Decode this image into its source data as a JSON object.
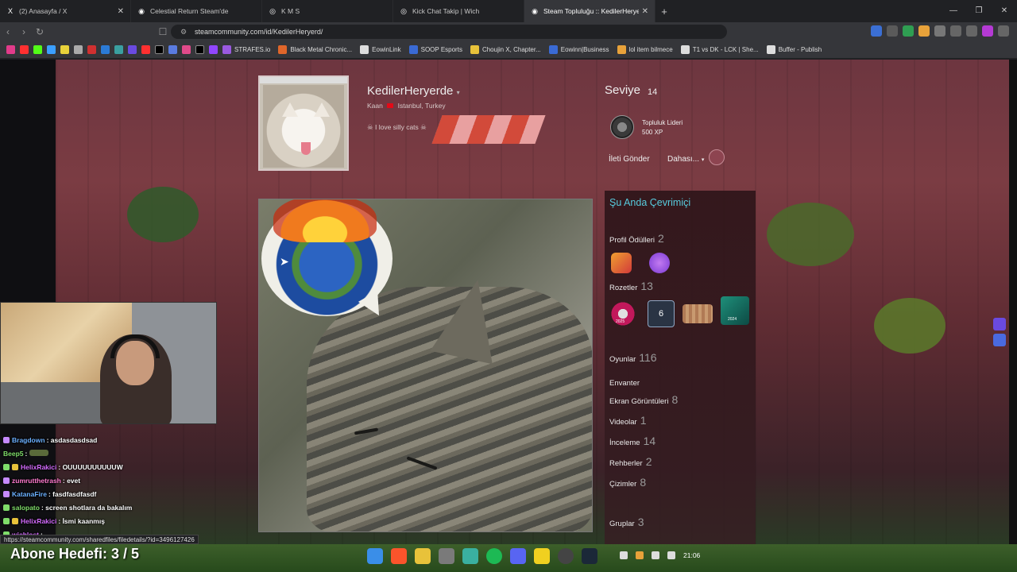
{
  "browser": {
    "tabs": [
      {
        "title": "(2) Anasayfa / X",
        "icon": "x-logo-icon"
      },
      {
        "title": "Celestial Return Steam'de",
        "icon": "steam-icon"
      },
      {
        "title": "K M S",
        "icon": "globe-icon"
      },
      {
        "title": "Kick Chat Takip | Wich",
        "icon": "globe-icon"
      },
      {
        "title": "Steam Topluluğu :: KedilerHeryerde",
        "icon": "steam-icon",
        "active": true
      }
    ],
    "url": "steamcommunity.com/id/KedilerHeryerd/",
    "bookmarks": [
      "STRAFES.io",
      "Black Metal Chronic...",
      "EowinLink",
      "SOOP Esports",
      "Choujin X, Chapter...",
      "Eowinn|Business",
      "lol item bilmece",
      "T1 vs DK - LCK | She...",
      "Buffer - Publish"
    ]
  },
  "profile": {
    "persona_name": "KedilerHeryerde",
    "real_name": "Kaan",
    "location": "Istanbul, Turkey",
    "summary": "I love silly cats",
    "level_label": "Seviye",
    "level": "14",
    "favorite_badge_name": "Topluluk Lideri",
    "favorite_badge_xp": "500 XP",
    "send_message": "İleti Gönder",
    "more": "Dahası..."
  },
  "sidebar": {
    "online_status": "Şu Anda Çevrimiçi",
    "awards_label": "Profil Ödülleri",
    "awards_count": "2",
    "badges_label": "Rozetler",
    "badges_count": "13",
    "badge_number": "6",
    "badge_year_1": "2025",
    "badge_year_2": "2024",
    "stats": [
      {
        "label": "Oyunlar",
        "count": "116"
      },
      {
        "label": "Envanter",
        "count": ""
      },
      {
        "label": "Ekran Görüntüleri",
        "count": "8"
      },
      {
        "label": "Videolar",
        "count": "1"
      },
      {
        "label": "İnceleme",
        "count": "14"
      },
      {
        "label": "Rehberler",
        "count": "2"
      },
      {
        "label": "Çizimler",
        "count": "8"
      }
    ],
    "groups_label": "Gruplar",
    "groups_count": "3"
  },
  "chat": [
    {
      "user": "Bragdown",
      "msg": ": asdasdasdsad",
      "color": "#6ab0ff"
    },
    {
      "user": "Beep5",
      "msg": ":",
      "color": "#7fdd6a"
    },
    {
      "user": "HelixRakici",
      "msg": ": OUUUUUUUUUUW",
      "color": "#d46bff"
    },
    {
      "user": "zumrutthetrash",
      "msg": ": evet",
      "color": "#ff7bd0"
    },
    {
      "user": "KatanaFire",
      "msg": ": fasdfasdfasdf",
      "color": "#6ab0ff"
    },
    {
      "user": "salopato",
      "msg": ": screen shotlara da bakalım",
      "color": "#7fdd6a"
    },
    {
      "user": "HelixRakici",
      "msg": ": İsmi kaanmış",
      "color": "#d46bff"
    },
    {
      "user": "wichlost",
      "msg": ":",
      "color": "#d46bff"
    }
  ],
  "status_bar_url": "https://steamcommunity.com/sharedfiles/filedetails/?id=3496127426",
  "stream_goal": "Abone Hedefi:  3 / 5",
  "clock": "21:06"
}
